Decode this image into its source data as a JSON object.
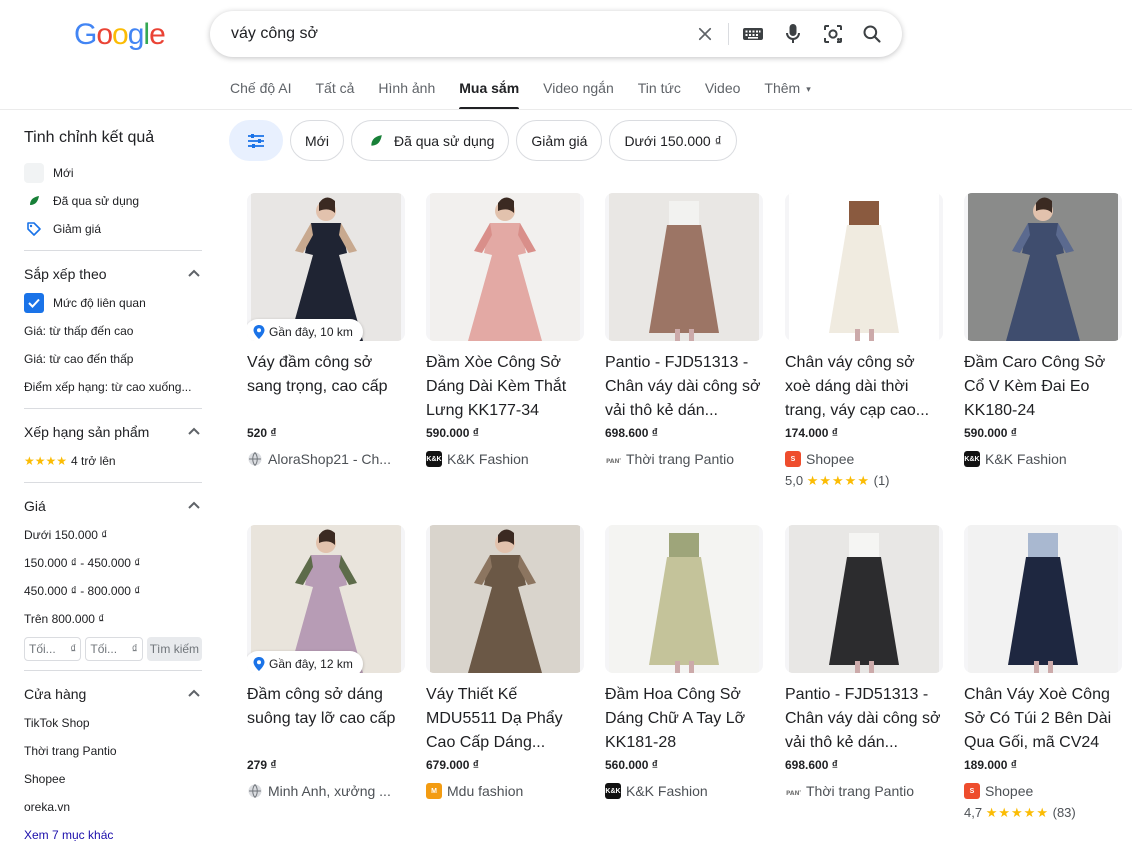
{
  "logo_letters": [
    {
      "char": "G",
      "color": "#4285f4"
    },
    {
      "char": "o",
      "color": "#ea4335"
    },
    {
      "char": "o",
      "color": "#fbbc05"
    },
    {
      "char": "g",
      "color": "#4285f4"
    },
    {
      "char": "l",
      "color": "#34a853"
    },
    {
      "char": "e",
      "color": "#ea4335"
    }
  ],
  "search": {
    "query": "váy công sở",
    "icons": [
      "clear-icon",
      "keyboard-icon",
      "microphone-icon",
      "lens-icon",
      "search-icon"
    ]
  },
  "tabs": [
    {
      "label": "Chế độ AI",
      "active": false
    },
    {
      "label": "Tất cả",
      "active": false
    },
    {
      "label": "Hình ảnh",
      "active": false
    },
    {
      "label": "Mua sắm",
      "active": true
    },
    {
      "label": "Video ngắn",
      "active": false
    },
    {
      "label": "Tin tức",
      "active": false
    },
    {
      "label": "Video",
      "active": false
    },
    {
      "label": "Thêm",
      "active": false
    }
  ],
  "sidebar": {
    "title": "Tinh chỉnh kết quả",
    "filters": [
      "Mới",
      "Đã qua sử dụng",
      "Giảm giá"
    ],
    "sort": {
      "heading": "Sắp xếp theo",
      "checked": "Mức độ liên quan",
      "options": [
        "Giá: từ thấp đến cao",
        "Giá: từ cao đến thấp",
        "Điểm xếp hạng: từ cao xuống..."
      ]
    },
    "rating": {
      "heading": "Xếp hạng sản phẩm",
      "stars": "★★★★",
      "label": "4 trở lên"
    },
    "price": {
      "heading": "Giá",
      "ranges": [
        "Dưới 150.000 ₫",
        "150.000 ₫ - 450.000 ₫",
        "450.000 ₫ - 800.000 ₫",
        "Trên 800.000 ₫"
      ],
      "min_placeholder": "Tối...",
      "max_placeholder": "Tối...",
      "currency": "₫",
      "search_button": "Tìm kiếm"
    },
    "stores": {
      "heading": "Cửa hàng",
      "items": [
        "TikTok Shop",
        "Thời trang Pantio",
        "Shopee",
        "oreka.vn"
      ],
      "more": "Xem 7 mục khác"
    }
  },
  "chips": [
    "Mới",
    "Đã qua sử dụng",
    "Giảm giá",
    "Dưới 150.000 ₫"
  ],
  "products": [
    {
      "title": "Váy đầm công sở sang trọng, cao cấp",
      "price": "520 ₫",
      "seller": "AloraShop21 - Ch...",
      "seller_icon": "globe-icon",
      "near": "Gần đây, 10 km",
      "colors": [
        "#1f2433",
        "#e8e6e4",
        "#c8a98f"
      ]
    },
    {
      "title": "Đầm Xòe Công Sở Dáng Dài Kèm Thắt Lưng KK177-34",
      "price": "590.000 ₫",
      "seller": "K&K Fashion",
      "seller_icon": "kk-logo-icon",
      "colors": [
        "#e3a9a4",
        "#f2f0ee",
        "#d98f8a"
      ]
    },
    {
      "title": "Pantio - FJD51313 - Chân váy dài công sở vải thô kẻ dán...",
      "price": "698.600 ₫",
      "seller": "Thời trang Pantio",
      "seller_icon": "pantio-logo-icon",
      "colors": [
        "#9c7565",
        "#e9e7e4",
        "#f2f2f0"
      ]
    },
    {
      "title": "Chân váy công sở xoè dáng dài thời trang, váy cạp cao...",
      "price": "174.000 ₫",
      "seller": "Shopee",
      "seller_icon": "shopee-logo-icon",
      "rating_value": "5,0",
      "rating_stars": "★★★★★",
      "rating_count": "(1)",
      "colors": [
        "#f0ebe0",
        "#ffffff",
        "#8a5a3f"
      ]
    },
    {
      "title": "Đầm Caro Công Sở Cổ V Kèm Đai Eo KK180-24",
      "price": "590.000 ₫",
      "seller": "K&K Fashion",
      "seller_icon": "kk-logo-icon",
      "colors": [
        "#3f4d6e",
        "#8a8b8a",
        "#5b6a8f"
      ]
    },
    {
      "title": "Đầm công sở dáng suông tay lỡ cao cấp",
      "price": "279 ₫",
      "seller": "Minh Anh, xưởng ...",
      "seller_icon": "globe-icon",
      "near": "Gần đây, 12 km",
      "colors": [
        "#b79cb5",
        "#e9e4dc",
        "#5d6b4a"
      ]
    },
    {
      "title": "Váy Thiết Kế MDU5511 Dạ Phẩy Cao Cấp Dáng...",
      "price": "679.000 ₫",
      "seller": "Mdu fashion",
      "seller_icon": "mdu-logo-icon",
      "colors": [
        "#6b5846",
        "#d9d4cc",
        "#8c7560"
      ]
    },
    {
      "title": "Đầm Hoa Công Sở Dáng Chữ A Tay Lỡ KK181-28",
      "price": "560.000 ₫",
      "seller": "K&K Fashion",
      "seller_icon": "kk-logo-icon",
      "colors": [
        "#c4c39a",
        "#f4f4f2",
        "#9ea57a"
      ]
    },
    {
      "title": "Pantio - FJD51313 - Chân váy dài công sở vải thô kẻ dán...",
      "price": "698.600 ₫",
      "seller": "Thời trang Pantio",
      "seller_icon": "pantio-logo-icon",
      "colors": [
        "#2c2c2e",
        "#e8e7e5",
        "#f5f5f3"
      ]
    },
    {
      "title": "Chân Váy Xoè Công Sở Có Túi 2 Bên Dài Qua Gối, mã CV24",
      "price": "189.000 ₫",
      "seller": "Shopee",
      "seller_icon": "shopee-logo-icon",
      "rating_value": "4,7",
      "rating_stars": "★★★★★",
      "rating_count": "(83)",
      "colors": [
        "#1e2740",
        "#f2f2f2",
        "#a9b8d0"
      ]
    }
  ]
}
